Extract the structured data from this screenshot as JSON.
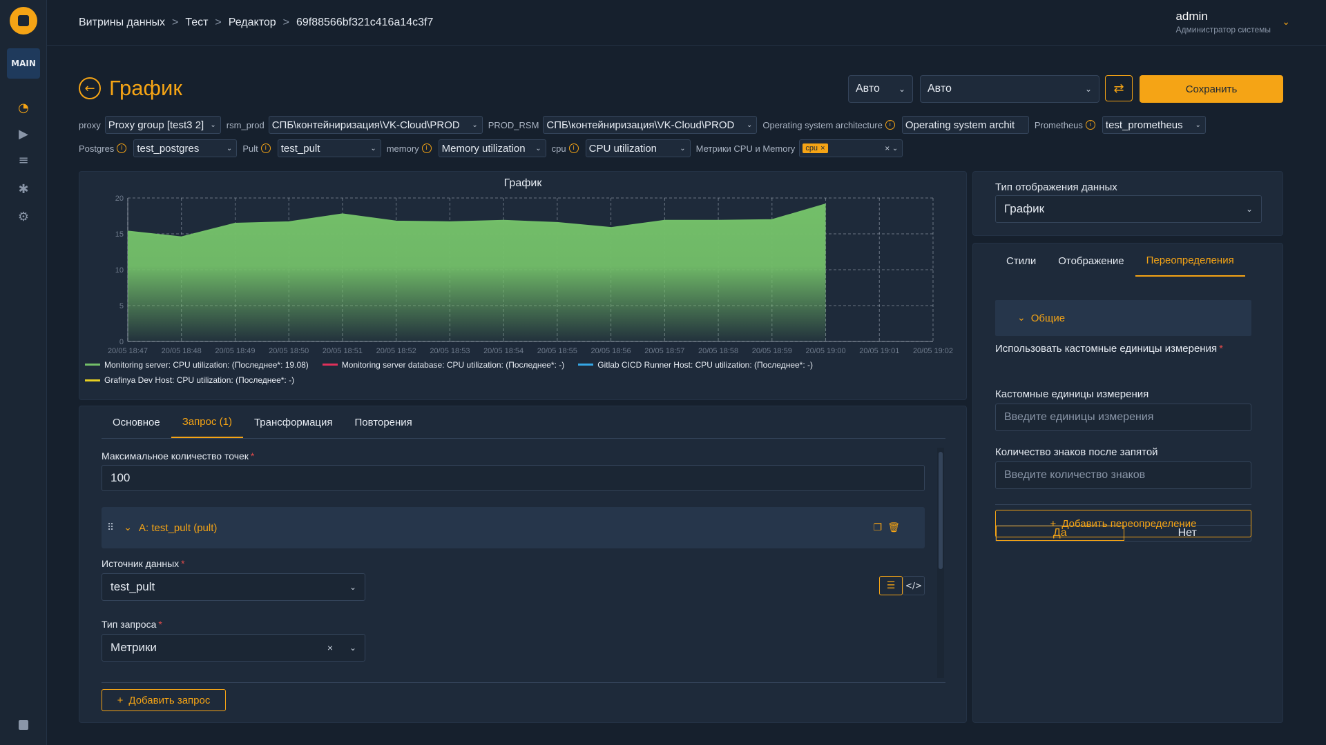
{
  "sidebar": {
    "main_badge": "MAIN",
    "nav_icons": [
      "dashboard-icon",
      "play-icon",
      "database-icon",
      "puzzle-icon",
      "gear-icon"
    ]
  },
  "breadcrumb": [
    "Витрины данных",
    "Тест",
    "Редактор",
    "69f88566bf321c416a14c3f7"
  ],
  "breadcrumb_sep": ">",
  "user": {
    "name": "admin",
    "role": "Администратор системы"
  },
  "page": {
    "title": "График"
  },
  "toolbar": {
    "auto_small": "Авто",
    "auto_large": "Авто",
    "save_label": "Сохранить"
  },
  "filters": {
    "proxy_label": "proxy",
    "proxy_value": "Proxy group [test3 2]",
    "rsm_prod_label": "rsm_prod",
    "rsm_prod_value": "СПБ\\контейниризация\\VK-Cloud\\PROD",
    "prod_rsm_label": "PROD_RSM",
    "prod_rsm_value": "СПБ\\контейниризация\\VK-Cloud\\PROD",
    "os_arch_label": "Operating system architecture",
    "os_arch_value": "Operating system archit",
    "prometheus_label": "Prometheus",
    "prometheus_value": "test_prometheus",
    "postgres_label": "Postgres",
    "postgres_value": "test_postgres",
    "pult_label": "Pult",
    "pult_value": "test_pult",
    "memory_label": "memory",
    "memory_value": "Memory utilization",
    "cpu_label": "cpu",
    "cpu_value": "CPU utilization",
    "metrics_label": "Метрики CPU и Memory",
    "metrics_tag": "cpu"
  },
  "chart_data": {
    "type": "area",
    "title": "График",
    "x": [
      "20/05 18:47",
      "20/05 18:48",
      "20/05 18:49",
      "20/05 18:50",
      "20/05 18:51",
      "20/05 18:52",
      "20/05 18:53",
      "20/05 18:54",
      "20/05 18:55",
      "20/05 18:56",
      "20/05 18:57",
      "20/05 18:58",
      "20/05 18:59",
      "20/05 19:00",
      "20/05 19:01",
      "20/05 19:02"
    ],
    "ylim": [
      0,
      20
    ],
    "yticks": [
      0,
      5,
      10,
      15,
      20
    ],
    "grid": true,
    "series": [
      {
        "name": "Monitoring server: CPU utilization: (Последнее*: 19.08)",
        "color": "#73bf69",
        "values": [
          15.3,
          14.5,
          16.4,
          16.6,
          17.7,
          16.7,
          16.6,
          16.8,
          16.5,
          15.8,
          16.8,
          16.8,
          16.9,
          19.08,
          null,
          null
        ]
      },
      {
        "name": "Monitoring server database: CPU utilization: (Последнее*: -)",
        "color": "#e0305a",
        "values": []
      },
      {
        "name": "Gitlab CICD Runner Host: CPU utilization: (Последнее*: -)",
        "color": "#35a7e6",
        "values": []
      },
      {
        "name": "Grafinya Dev Host: CPU utilization: (Последнее*: -)",
        "color": "#e8d022",
        "values": []
      }
    ]
  },
  "query_panel": {
    "tabs": [
      "Основное",
      "Запрос (1)",
      "Трансформация",
      "Повторения"
    ],
    "max_points_label": "Максимальное количество точек",
    "max_points_value": "100",
    "query_title": "A: test_pult (pult)",
    "datasource_label": "Источник данных",
    "datasource_value": "test_pult",
    "query_type_label": "Тип запроса",
    "query_type_value": "Метрики",
    "add_query_label": "Добавить запрос"
  },
  "right_panel": {
    "display_type_label": "Тип отображения данных",
    "display_type_value": "График",
    "tabs": [
      "Стили",
      "Отображение",
      "Переопределения"
    ],
    "section_title": "Общие",
    "custom_units_q": "Использовать кастомные единицы измерения",
    "yes": "Да",
    "no": "Нет",
    "custom_units_label": "Кастомные единицы измерения",
    "custom_units_placeholder": "Введите единицы измерения",
    "decimals_label": "Количество знаков после запятой",
    "decimals_placeholder": "Введите количество знаков",
    "add_override_label": "Добавить переопределение"
  }
}
